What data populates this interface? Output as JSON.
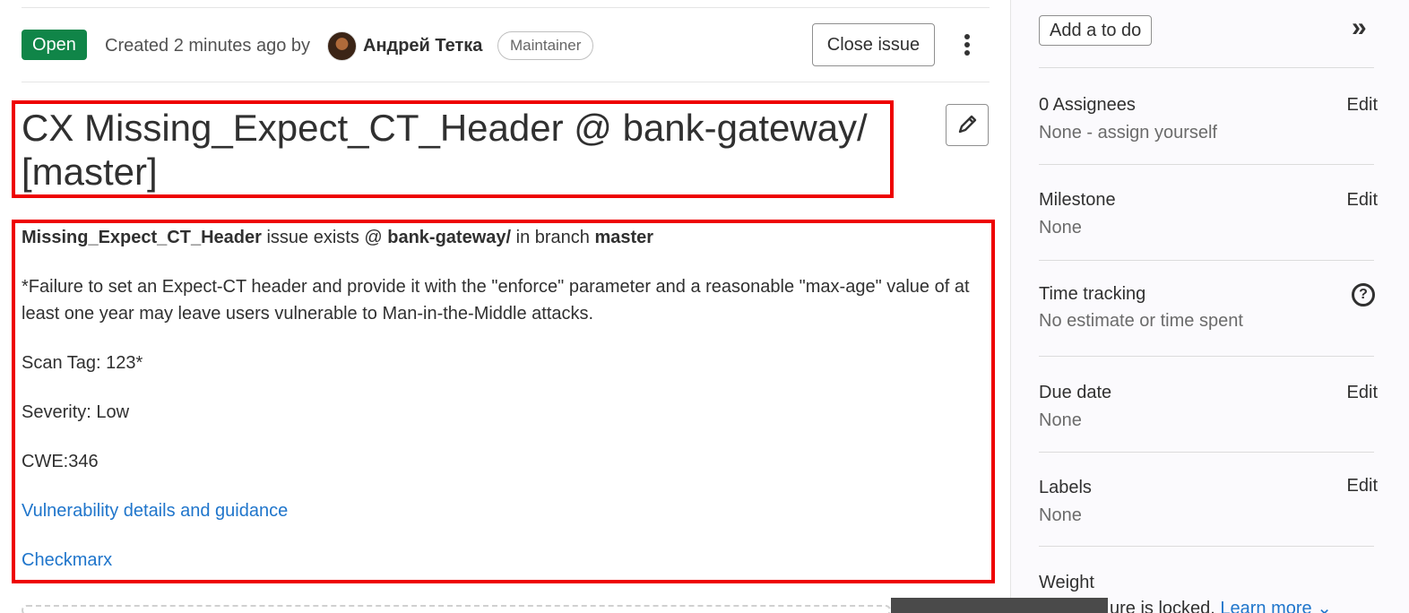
{
  "header": {
    "status": "Open",
    "created_text": "Created 2 minutes ago by",
    "author": "Андрей Тетка",
    "role": "Maintainer",
    "close_button": "Close issue"
  },
  "title": "CX Missing_Expect_CT_Header @ bank-gateway/ [master]",
  "description": {
    "query": "Missing_Expect_CT_Header",
    "exists_text": " issue exists @ ",
    "project": "bank-gateway/",
    "branch_text": " in branch ",
    "branch": "master",
    "paragraph": "*Failure to set an Expect-CT header and provide it with the \"enforce\" parameter and a reasonable \"max-age\" value of at least one year may leave users vulnerable to Man-in-the-Middle attacks.",
    "scan_tag": "Scan Tag: 123*",
    "severity": "Severity: Low",
    "cwe": "CWE:346",
    "link_details": "Vulnerability details and guidance",
    "link_checkmarx": "Checkmarx"
  },
  "sidebar": {
    "todo_button": "Add a to do",
    "edit_label": "Edit",
    "assignees_title": "0 Assignees",
    "assignees_value": "None - assign yourself",
    "milestone_title": "Milestone",
    "milestone_value": "None",
    "time_title": "Time tracking",
    "time_value": "No estimate or time spent",
    "due_title": "Due date",
    "due_value": "None",
    "labels_title": "Labels",
    "labels_value": "None",
    "weight_title": "Weight",
    "weight_locked": "ure is locked.",
    "weight_learn_more": "Learn more"
  }
}
